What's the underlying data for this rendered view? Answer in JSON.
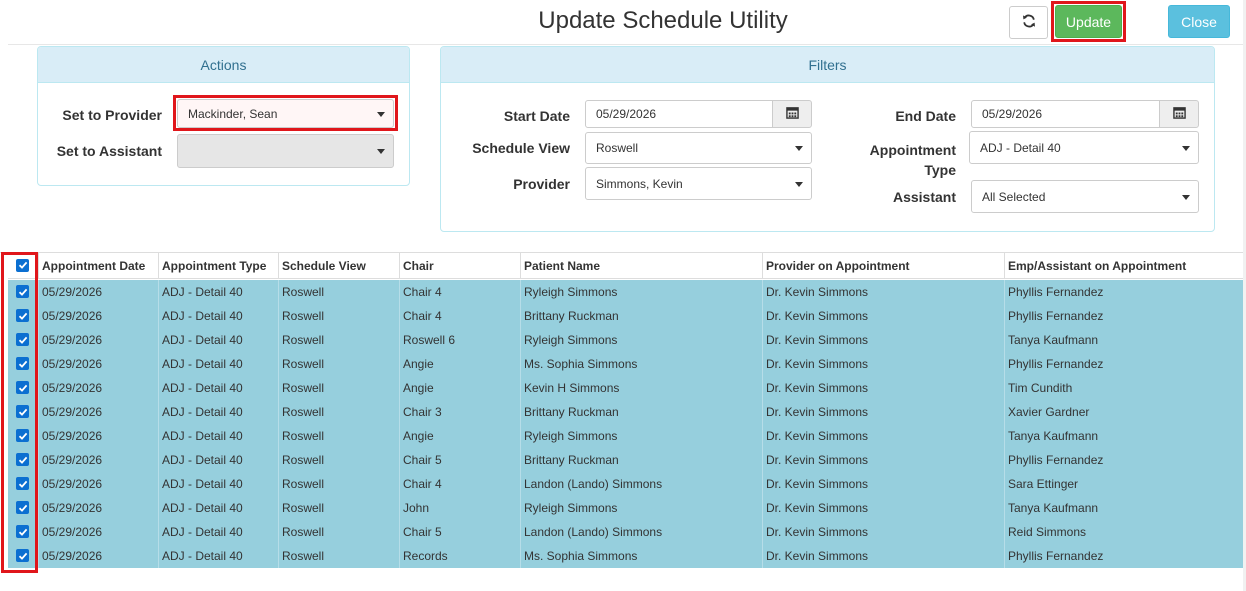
{
  "title": "Update Schedule Utility",
  "toolbar": {
    "refresh_icon": "refresh-icon",
    "update_label": "Update",
    "close_label": "Close"
  },
  "actions": {
    "heading": "Actions",
    "set_provider_label": "Set to Provider",
    "set_provider_value": "Mackinder, Sean",
    "set_assistant_label": "Set to Assistant",
    "set_assistant_value": ""
  },
  "filters": {
    "heading": "Filters",
    "start_date_label": "Start Date",
    "start_date_value": "05/29/2026",
    "schedule_view_label": "Schedule View",
    "schedule_view_value": "Roswell",
    "provider_label": "Provider",
    "provider_value": "Simmons, Kevin",
    "end_date_label": "End Date",
    "end_date_value": "05/29/2026",
    "appointment_type_label_1": "Appointment",
    "appointment_type_label_2": "Type",
    "appointment_type_value": "ADJ - Detail 40",
    "assistant_label": "Assistant",
    "assistant_value": "All Selected"
  },
  "grid": {
    "columns": [
      "Appointment Date",
      "Appointment Type",
      "Schedule View",
      "Chair",
      "Patient Name",
      "Provider on Appointment",
      "Emp/Assistant on Appointment"
    ],
    "rows": [
      [
        "05/29/2026",
        "ADJ - Detail 40",
        "Roswell",
        "Chair 4",
        "Ryleigh Simmons",
        "Dr. Kevin Simmons",
        "Phyllis Fernandez"
      ],
      [
        "05/29/2026",
        "ADJ - Detail 40",
        "Roswell",
        "Chair 4",
        "Brittany Ruckman",
        "Dr. Kevin Simmons",
        "Phyllis Fernandez"
      ],
      [
        "05/29/2026",
        "ADJ - Detail 40",
        "Roswell",
        "Roswell 6",
        "Ryleigh Simmons",
        "Dr. Kevin Simmons",
        "Tanya Kaufmann"
      ],
      [
        "05/29/2026",
        "ADJ - Detail 40",
        "Roswell",
        "Angie",
        "Ms. Sophia Simmons",
        "Dr. Kevin Simmons",
        "Phyllis Fernandez"
      ],
      [
        "05/29/2026",
        "ADJ - Detail 40",
        "Roswell",
        "Angie",
        "Kevin H Simmons",
        "Dr. Kevin Simmons",
        "Tim Cundith"
      ],
      [
        "05/29/2026",
        "ADJ - Detail 40",
        "Roswell",
        "Chair 3",
        "Brittany Ruckman",
        "Dr. Kevin Simmons",
        "Xavier Gardner"
      ],
      [
        "05/29/2026",
        "ADJ - Detail 40",
        "Roswell",
        "Angie",
        "Ryleigh Simmons",
        "Dr. Kevin Simmons",
        "Tanya Kaufmann"
      ],
      [
        "05/29/2026",
        "ADJ - Detail 40",
        "Roswell",
        "Chair 5",
        "Brittany Ruckman",
        "Dr. Kevin Simmons",
        "Phyllis Fernandez"
      ],
      [
        "05/29/2026",
        "ADJ - Detail 40",
        "Roswell",
        "Chair 4",
        "Landon (Lando) Simmons",
        "Dr. Kevin Simmons",
        "Sara Ettinger"
      ],
      [
        "05/29/2026",
        "ADJ - Detail 40",
        "Roswell",
        "John",
        "Ryleigh Simmons",
        "Dr. Kevin Simmons",
        "Tanya Kaufmann"
      ],
      [
        "05/29/2026",
        "ADJ - Detail 40",
        "Roswell",
        "Chair 5",
        "Landon (Lando) Simmons",
        "Dr. Kevin Simmons",
        "Reid Simmons"
      ],
      [
        "05/29/2026",
        "ADJ - Detail 40",
        "Roswell",
        "Records",
        "Ms. Sophia Simmons",
        "Dr. Kevin Simmons",
        "Phyllis Fernandez"
      ]
    ]
  },
  "colors": {
    "selected_row": "#96cfdd",
    "highlight": "#e0161b",
    "update": "#5cb85c",
    "close": "#5bc0de"
  }
}
